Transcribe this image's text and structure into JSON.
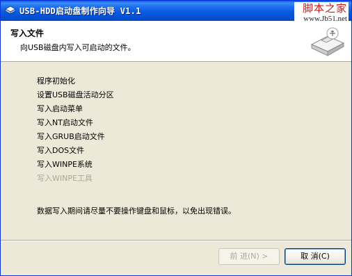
{
  "window": {
    "title": "USB-HDD启动盘制作向导 V1.1"
  },
  "watermark": {
    "logo": "脚本之家",
    "url": "www.Jb51.net"
  },
  "header": {
    "title": "写入文件",
    "subtitle": "向USB磁盘内写入可启动的文件。"
  },
  "steps": [
    {
      "label": "程序初始化",
      "enabled": true
    },
    {
      "label": "设置USB磁盘活动分区",
      "enabled": true
    },
    {
      "label": "写入启动菜单",
      "enabled": true
    },
    {
      "label": "写入NT启动文件",
      "enabled": true
    },
    {
      "label": "写入GRUB启动文件",
      "enabled": true
    },
    {
      "label": "写入DOS文件",
      "enabled": true
    },
    {
      "label": "写入WINPE系统",
      "enabled": true
    },
    {
      "label": "写入WINPE工具",
      "enabled": false
    }
  ],
  "notice": "数据写入期间请尽量不要操作键盘和鼠标，以免出现错误。",
  "buttons": {
    "next": "前 进(N) >",
    "cancel": "取 消(C)"
  },
  "colors": {
    "titlebar": "#0758de",
    "dialog_bg": "#ece9d8",
    "disabled_text": "#aca899",
    "watermark_red": "#c41a1a"
  },
  "icons": {
    "title": "wizard-app-icon",
    "header": "usb-drive-icon"
  }
}
